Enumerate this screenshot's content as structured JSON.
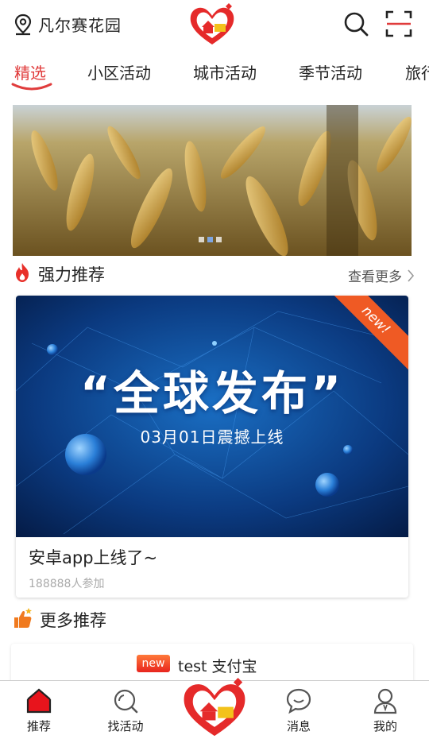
{
  "header": {
    "location": "凡尔赛花园",
    "icons": [
      "location-icon",
      "app-logo",
      "search-icon",
      "scan-icon"
    ]
  },
  "tabs": [
    {
      "label": "精选",
      "active": true
    },
    {
      "label": "小区活动",
      "active": false
    },
    {
      "label": "城市活动",
      "active": false
    },
    {
      "label": "季节活动",
      "active": false
    },
    {
      "label": "旅行",
      "active": false
    }
  ],
  "banner": {
    "dots": 3,
    "active_dot": 2
  },
  "recommend": {
    "title": "强力推荐",
    "more": "查看更多",
    "card": {
      "poster_title": "“全球发布”",
      "poster_subtitle": "03月01日震撼上线",
      "ribbon": "new!",
      "title": "安卓app上线了~",
      "participants": "188888人参加"
    }
  },
  "more_recommend": {
    "title": "更多推荐",
    "item": {
      "badge": "new",
      "text": "test 支付宝"
    }
  },
  "bottom_nav": [
    {
      "label": "推荐",
      "icon": "home-icon"
    },
    {
      "label": "找活动",
      "icon": "search-icon"
    },
    {
      "label": "",
      "icon": "app-logo"
    },
    {
      "label": "消息",
      "icon": "message-icon"
    },
    {
      "label": "我的",
      "icon": "user-icon"
    }
  ],
  "colors": {
    "accent": "#e03c3c",
    "ribbon": "#ef5a24",
    "poster_bg": "#0a2f6a"
  }
}
